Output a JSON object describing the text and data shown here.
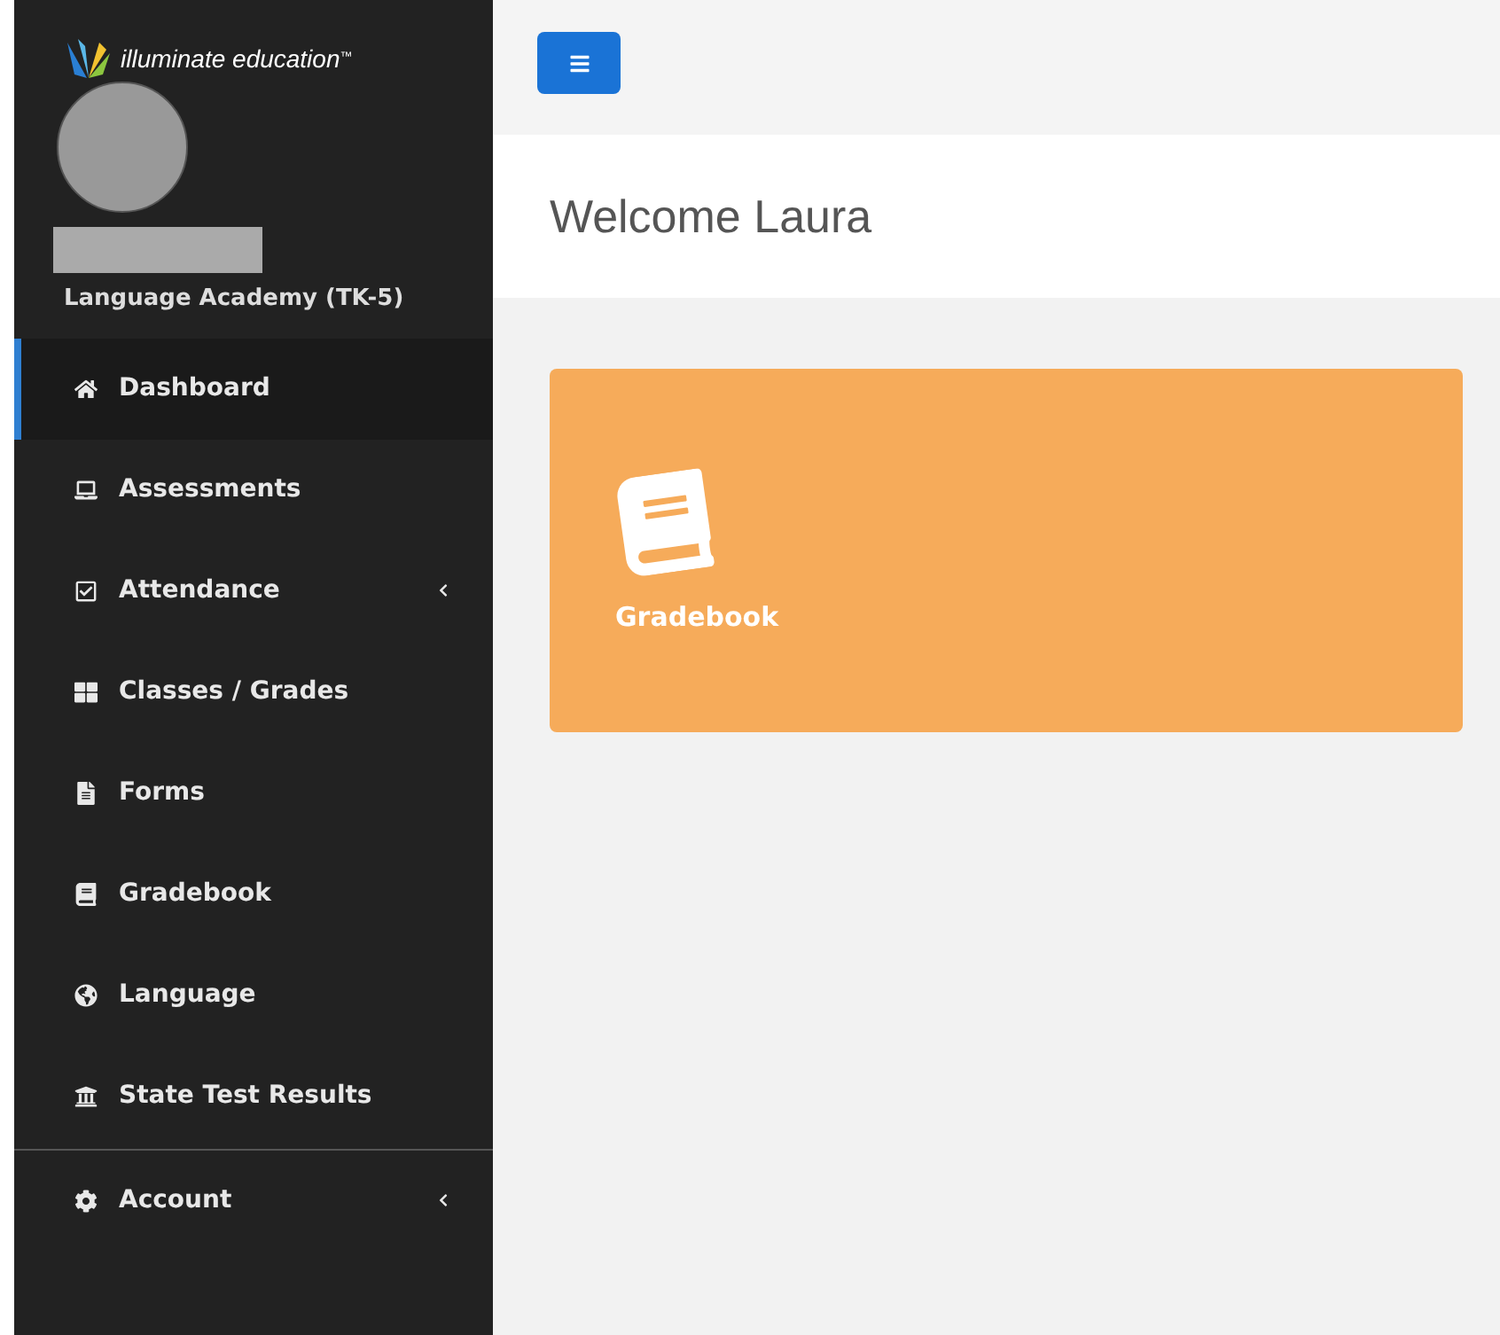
{
  "sidebar": {
    "logo": {
      "text": "illuminate education",
      "mark": "™"
    },
    "school": "Language Academy (TK-5)",
    "items": [
      {
        "label": "Dashboard",
        "selected": true,
        "expandable": false
      },
      {
        "label": "Assessments",
        "selected": false,
        "expandable": false
      },
      {
        "label": "Attendance",
        "selected": false,
        "expandable": true
      },
      {
        "label": "Classes / Grades",
        "selected": false,
        "expandable": false
      },
      {
        "label": "Forms",
        "selected": false,
        "expandable": false
      },
      {
        "label": "Gradebook",
        "selected": false,
        "expandable": false
      },
      {
        "label": "Language",
        "selected": false,
        "expandable": false
      },
      {
        "label": "State Test Results",
        "selected": false,
        "expandable": false
      }
    ],
    "footer_items": [
      {
        "label": "Account",
        "selected": false,
        "expandable": true
      }
    ]
  },
  "header": {
    "title": "Welcome Laura"
  },
  "tiles": [
    {
      "label": "Gradebook",
      "color": "#f6ab5a"
    }
  ]
}
